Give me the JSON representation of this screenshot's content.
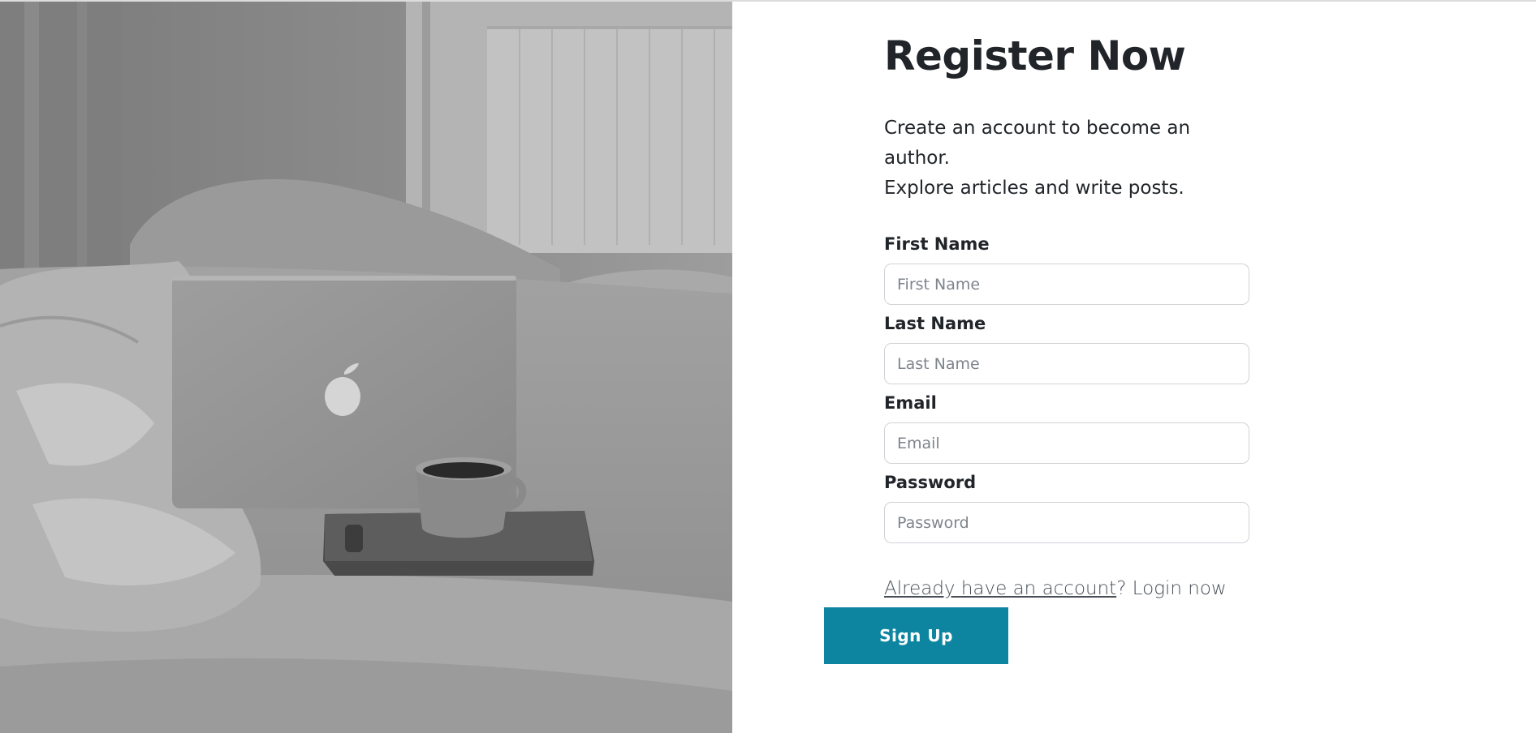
{
  "hero_image": {
    "description_icon": "laptop-on-bed-photo"
  },
  "form": {
    "title": "Register Now",
    "subtitle_line1": "Create an account to become an author.",
    "subtitle_line2": "Explore articles and write posts.",
    "fields": [
      {
        "label": "First Name",
        "placeholder": "First Name",
        "value": ""
      },
      {
        "label": "Last Name",
        "placeholder": "Last Name",
        "value": ""
      },
      {
        "label": "Email",
        "placeholder": "Email",
        "value": ""
      },
      {
        "label": "Password",
        "placeholder": "Password",
        "value": ""
      }
    ],
    "login_link_text": "Already have an account",
    "login_suffix": "? Login now",
    "submit_label": "Sign Up"
  },
  "colors": {
    "accent": "#0e85a0",
    "text": "#212529",
    "input_border": "#cfd3d7"
  }
}
